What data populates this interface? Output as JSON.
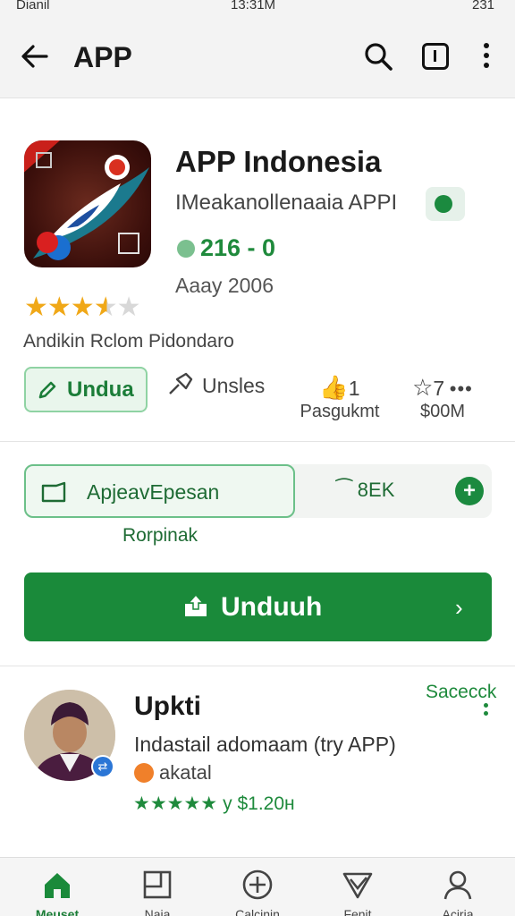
{
  "status_bar": {
    "left": "Dianil",
    "time": "13:31M",
    "battery": "231"
  },
  "appbar": {
    "title": "APP",
    "icons": [
      "back-arrow-icon",
      "search-icon",
      "tab-icon",
      "more-vert-icon"
    ]
  },
  "app": {
    "name": "APP Indonesia",
    "developer": "IMeakanollenaaia APPI",
    "downloads": "216 - 0",
    "date": "Aaay 2006",
    "rating_stars": 3.5,
    "tagline": "Andikin Rclom Pidondaro"
  },
  "actions": {
    "install_small": "Undua",
    "share": "Unsles",
    "likes": "1",
    "likes_label": "Pasgukmt",
    "rank": "7",
    "rank_label": "$00M",
    "rank_more": "•••"
  },
  "promo": {
    "left_text": "ApjeavEpesan",
    "right_text": "⁀ 8EK",
    "plus": "+",
    "subtitle": "Rorpinak"
  },
  "main_button": {
    "label": "Unduuh",
    "chevron": "›"
  },
  "review": {
    "name": "Upkti",
    "action": "Sacecck",
    "text": "Indastail adomaam (try APP)",
    "sub": "akatal",
    "stars": "★★★★★",
    "meta": "y  $1.20н",
    "badge": "⇄"
  },
  "bottom_nav": [
    {
      "label": "Meuset",
      "icon": "home-icon",
      "active": true
    },
    {
      "label": "Naja",
      "icon": "grid-icon",
      "active": false
    },
    {
      "label": "Calcinin",
      "icon": "add-circle-icon",
      "active": false
    },
    {
      "label": "Fenit",
      "icon": "send-icon",
      "active": false
    },
    {
      "label": "Aciria",
      "icon": "profile-icon",
      "active": false
    }
  ],
  "colors": {
    "primary_green": "#1a8a3a",
    "star_gold": "#f0a818",
    "light_green_bg": "#e9f6ec"
  }
}
